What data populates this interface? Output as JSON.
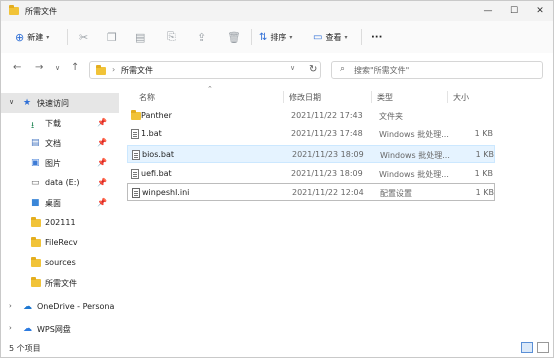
{
  "window": {
    "title": "所需文件",
    "controls": {
      "minimize": "—",
      "maximize": "☐",
      "close": "✕"
    }
  },
  "toolbar": {
    "new_label": "新建",
    "sort_label": "排序",
    "view_label": "查看",
    "more_label": "···"
  },
  "address": {
    "crumb": "所需文件",
    "search_placeholder": "搜索\"所需文件\""
  },
  "sidebar": {
    "quick_access": "快速访问",
    "items": [
      {
        "label": "下载",
        "icon": "download-icon",
        "pinned": true
      },
      {
        "label": "文档",
        "icon": "document-icon",
        "pinned": true
      },
      {
        "label": "图片",
        "icon": "picture-icon",
        "pinned": true
      },
      {
        "label": "data (E:)",
        "icon": "drive-icon",
        "pinned": true
      },
      {
        "label": "桌面",
        "icon": "desktop-icon",
        "pinned": true
      },
      {
        "label": "202111",
        "icon": "folder-icon",
        "pinned": false
      },
      {
        "label": "FileRecv",
        "icon": "folder-icon",
        "pinned": false
      },
      {
        "label": "sources",
        "icon": "folder-icon",
        "pinned": false
      },
      {
        "label": "所需文件",
        "icon": "folder-icon",
        "pinned": false
      }
    ],
    "onedrive": "OneDrive - Persona",
    "wps": "WPS网盘"
  },
  "columns": {
    "name": "名称",
    "date": "修改日期",
    "type": "类型",
    "size": "大小"
  },
  "files": [
    {
      "name": "Panther",
      "date": "2021/11/22 17:43",
      "type": "文件夹",
      "size": "",
      "icon": "folder-icon"
    },
    {
      "name": "1.bat",
      "date": "2021/11/23 17:48",
      "type": "Windows 批处理...",
      "size": "1 KB",
      "icon": "batch-file-icon"
    },
    {
      "name": "bios.bat",
      "date": "2021/11/23 18:09",
      "type": "Windows 批处理...",
      "size": "1 KB",
      "icon": "batch-file-icon"
    },
    {
      "name": "uefi.bat",
      "date": "2021/11/23 18:09",
      "type": "Windows 批处理...",
      "size": "1 KB",
      "icon": "batch-file-icon"
    },
    {
      "name": "winpeshl.ini",
      "date": "2021/11/22 12:04",
      "type": "配置设置",
      "size": "1 KB",
      "icon": "settings-file-icon"
    }
  ],
  "status": {
    "count": "5 个项目"
  }
}
